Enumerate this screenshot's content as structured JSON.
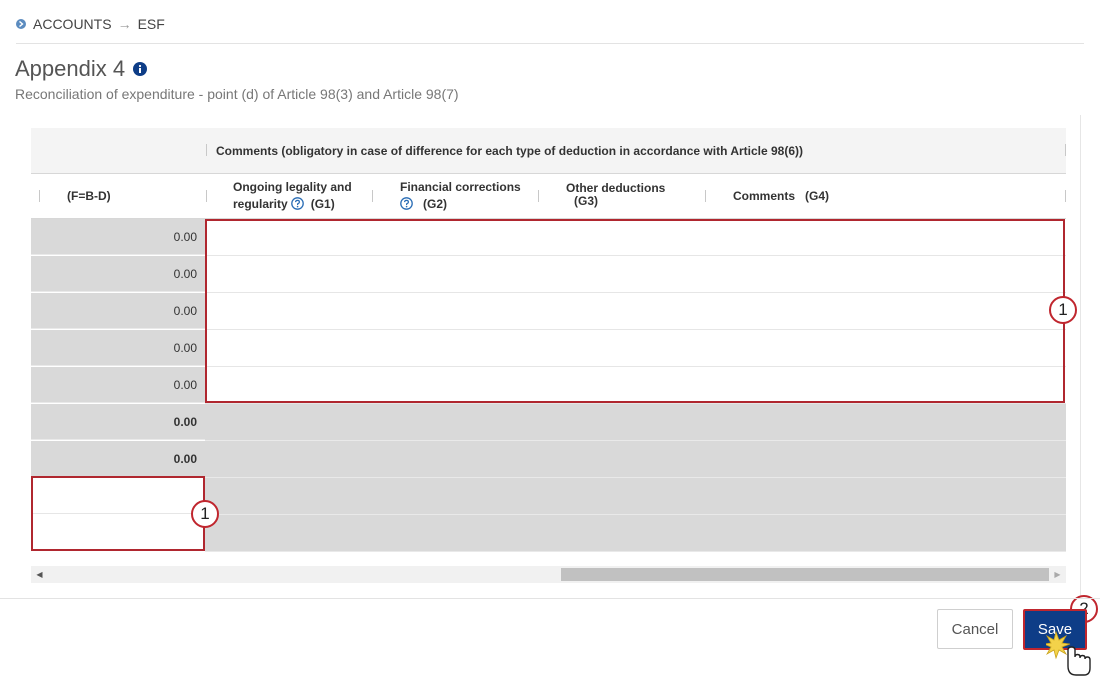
{
  "breadcrumb": {
    "items": [
      "ACCOUNTS",
      "ESF"
    ],
    "separator": "→"
  },
  "page": {
    "title": "Appendix 4",
    "subtitle": "Reconciliation of expenditure - point (d) of Article 98(3) and Article 98(7)"
  },
  "table": {
    "group_header": "Comments (obligatory in case of difference for each type of deduction in accordance with Article 98(6))",
    "columns": {
      "f": "(F=B-D)",
      "g1_line1": "Ongoing legality and",
      "g1_line2": "regularity",
      "g1_code": "(G1)",
      "g2_line1": "Financial corrections",
      "g2_code": "(G2)",
      "g3_line1": "Other deductions",
      "g3_code": "(G3)",
      "g4": "Comments",
      "g4_code": "(G4)"
    },
    "rows": [
      {
        "f": "0.00"
      },
      {
        "f": "0.00"
      },
      {
        "f": "0.00"
      },
      {
        "f": "0.00"
      },
      {
        "f": "0.00"
      },
      {
        "f": "0.00"
      },
      {
        "f": "0.00"
      },
      {
        "f": ""
      },
      {
        "f": ""
      }
    ]
  },
  "callouts": {
    "one": "1",
    "one_b": "1",
    "two": "2"
  },
  "buttons": {
    "cancel": "Cancel",
    "save": "Save"
  },
  "colors": {
    "accent": "#0e3d87",
    "highlight": "#b0272f",
    "readonly_cell": "#d9d9d9"
  }
}
